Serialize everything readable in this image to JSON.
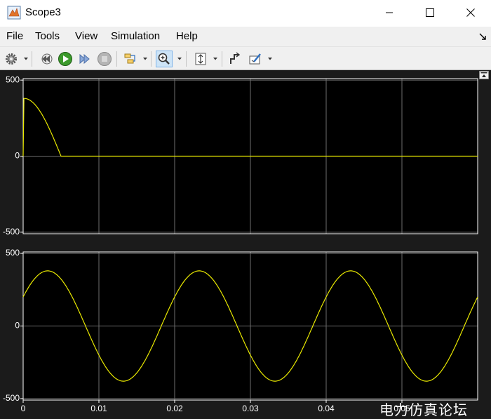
{
  "window": {
    "title": "Scope3",
    "minimize_icon": "minimize-icon",
    "maximize_icon": "maximize-icon",
    "close_icon": "close-icon"
  },
  "menu": {
    "items": [
      "File",
      "Tools",
      "View",
      "Simulation",
      "Help"
    ]
  },
  "toolbar": {
    "icons": [
      "gear-icon",
      "step-back-icon",
      "run-icon",
      "step-forward-icon",
      "stop-icon",
      "signal-selector-icon",
      "zoom-in-icon",
      "scale-axes-icon",
      "cursor-measure-icon",
      "highlight-icon"
    ]
  },
  "colors": {
    "plot_bg": "#000000",
    "figure_bg": "#1b1b1b",
    "trace": "#e8e800",
    "grid": "#6e6e6e",
    "axis": "#ffffff"
  },
  "watermark": "电力仿真论坛",
  "chart_data": [
    {
      "type": "line",
      "title": "",
      "xlabel": "",
      "ylabel": "",
      "xlim": [
        0,
        0.06
      ],
      "ylim": [
        -510,
        510
      ],
      "yticks": [
        500,
        0,
        -500
      ],
      "ytick_labels": [
        "500",
        "0",
        "-500"
      ],
      "grid": true,
      "series": [
        {
          "description": "half-wave decay to zero",
          "x": [
            0,
            0.0001,
            0.001,
            0.002,
            0.003,
            0.004,
            0.005,
            0.006,
            0.01,
            0.02,
            0.03,
            0.04,
            0.05,
            0.06
          ],
          "y": [
            0,
            380,
            360,
            300,
            200,
            100,
            0,
            0,
            0,
            0,
            0,
            0,
            0,
            0
          ]
        }
      ]
    },
    {
      "type": "line",
      "title": "",
      "xlabel": "",
      "ylabel": "",
      "xlim": [
        0,
        0.06
      ],
      "ylim": [
        -510,
        510
      ],
      "yticks": [
        500,
        0,
        -500
      ],
      "ytick_labels": [
        "500",
        "0",
        "-500"
      ],
      "xticks": [
        0,
        0.01,
        0.02,
        0.03,
        0.04,
        0.05
      ],
      "xtick_labels": [
        "0",
        "0.01",
        "0.02",
        "0.03",
        "0.04",
        "0.05"
      ],
      "grid": true,
      "series": [
        {
          "description": "sinusoid, amplitude ~380, frequency 50 Hz",
          "amplitude": 380,
          "frequency_hz": 50,
          "value_at_t0": 200
        }
      ]
    }
  ]
}
